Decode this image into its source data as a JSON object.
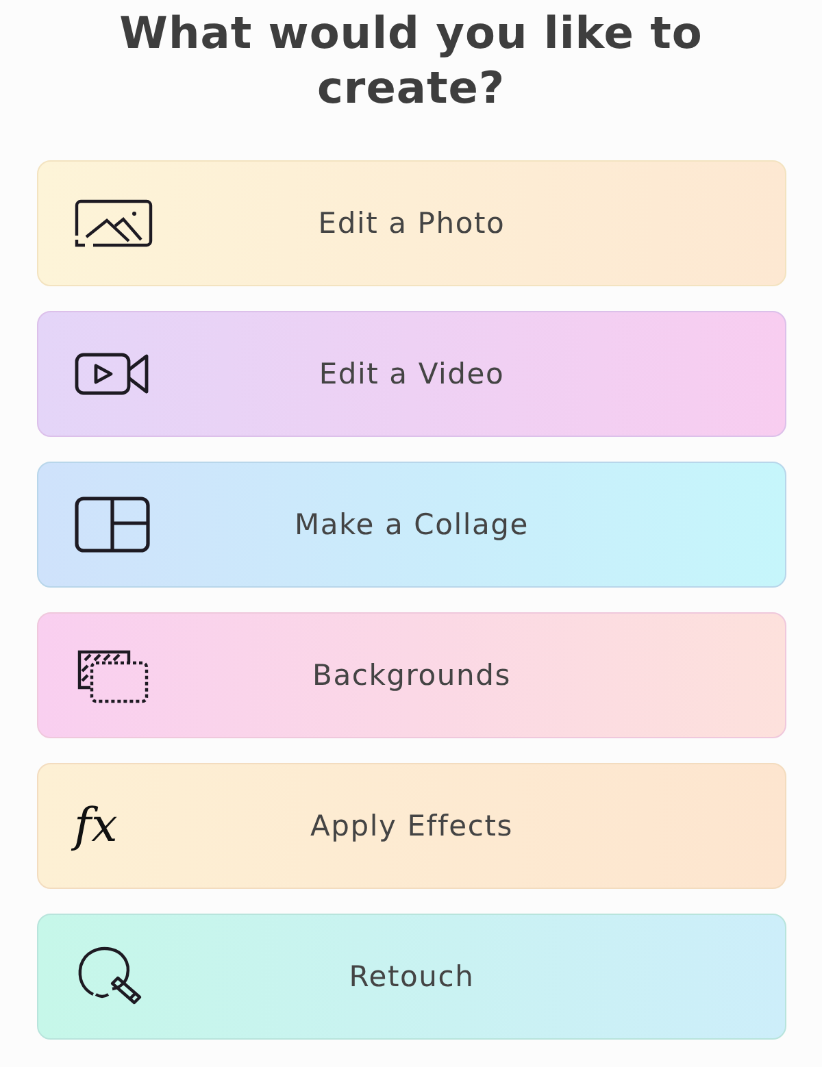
{
  "title": "What would you like to create?",
  "options": [
    {
      "kind": "photo",
      "label": "Edit a Photo"
    },
    {
      "kind": "video",
      "label": "Edit a Video"
    },
    {
      "kind": "collage",
      "label": "Make a Collage"
    },
    {
      "kind": "backgrounds",
      "label": "Backgrounds"
    },
    {
      "kind": "effects",
      "label": "Apply Effects",
      "glyph": "fx"
    },
    {
      "kind": "retouch",
      "label": "Retouch"
    }
  ]
}
